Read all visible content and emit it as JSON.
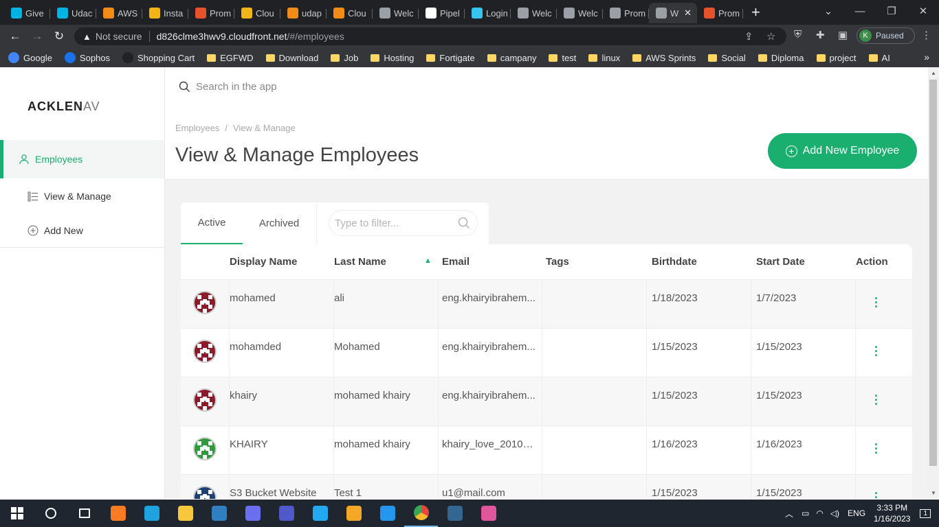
{
  "browser": {
    "tabs": [
      {
        "title": "Give",
        "icon": "udacity-icon",
        "color": "#02b3e4"
      },
      {
        "title": "Udac",
        "icon": "udacity-icon",
        "color": "#02b3e4"
      },
      {
        "title": "AWS",
        "icon": "aws-icon",
        "color": "#f28b18"
      },
      {
        "title": "Insta",
        "icon": "package-icon",
        "color": "#f2b418"
      },
      {
        "title": "Prom",
        "icon": "prometheus-icon",
        "color": "#e6522c"
      },
      {
        "title": "Clou",
        "icon": "cloudformation-icon",
        "color": "#f2b418"
      },
      {
        "title": "udap",
        "icon": "aws-icon",
        "color": "#f28b18"
      },
      {
        "title": "Clou",
        "icon": "aws-icon",
        "color": "#f28b18"
      },
      {
        "title": "Welc",
        "icon": "globe-icon",
        "color": "#9aa0a6"
      },
      {
        "title": "Pipel",
        "icon": "circleci-icon",
        "color": "#ffffff"
      },
      {
        "title": "Login",
        "icon": "slack-icon",
        "color": "#36c5f0"
      },
      {
        "title": "Welc",
        "icon": "globe-icon",
        "color": "#9aa0a6"
      },
      {
        "title": "Welc",
        "icon": "globe-icon",
        "color": "#9aa0a6"
      },
      {
        "title": "Prom",
        "icon": "page-icon",
        "color": "#9aa0a6"
      },
      {
        "title": "W",
        "icon": "globe-icon",
        "color": "#9aa0a6",
        "active": true
      },
      {
        "title": "Prom",
        "icon": "prometheus-icon",
        "color": "#e6522c"
      }
    ],
    "security_label": "Not secure",
    "url_host": "d826clme3hwv9.cloudfront.net",
    "url_path": "/#/employees",
    "profile_initial": "K",
    "profile_status": "Paused",
    "bookmarks": [
      {
        "label": "Google",
        "type": "site",
        "color": "#4285f4"
      },
      {
        "label": "Sophos",
        "type": "site",
        "color": "#1a73e8"
      },
      {
        "label": "Shopping Cart",
        "type": "site",
        "color": "#222"
      },
      {
        "label": "EGFWD",
        "type": "folder"
      },
      {
        "label": "Download",
        "type": "folder"
      },
      {
        "label": "Job",
        "type": "folder"
      },
      {
        "label": "Hosting",
        "type": "folder"
      },
      {
        "label": "Fortigate",
        "type": "folder"
      },
      {
        "label": "campany",
        "type": "folder"
      },
      {
        "label": "test",
        "type": "folder"
      },
      {
        "label": "linux",
        "type": "folder"
      },
      {
        "label": "AWS Sprints",
        "type": "folder"
      },
      {
        "label": "Social",
        "type": "folder"
      },
      {
        "label": "Diploma",
        "type": "folder"
      },
      {
        "label": "project",
        "type": "folder"
      },
      {
        "label": "AI",
        "type": "folder"
      }
    ]
  },
  "app": {
    "logo_bold": "ACKLEN",
    "logo_light": "AV",
    "search_placeholder": "Search in the app",
    "sidebar": {
      "section": "Employees",
      "items": [
        {
          "label": "View & Manage",
          "icon": "list-icon"
        },
        {
          "label": "Add New",
          "icon": "plus-circle-icon"
        }
      ]
    },
    "breadcrumb": [
      "Employees",
      "/",
      "View & Manage"
    ],
    "title": "View & Manage Employees",
    "add_button": "Add New Employee",
    "tabs": [
      "Active",
      "Archived"
    ],
    "filter_placeholder": "Type to filter...",
    "columns": [
      "Display Name",
      "Last Name",
      "Email",
      "Tags",
      "Birthdate",
      "Start Date",
      "Action"
    ],
    "rows": [
      {
        "display_name": "mohamed",
        "last_name": "ali",
        "email": "eng.khairyibrahem...",
        "tags": "",
        "birthdate": "1/18/2023",
        "start_date": "1/7/2023",
        "avatar_color": "#8b1a2b"
      },
      {
        "display_name": "mohamded",
        "last_name": "Mohamed",
        "email": "eng.khairyibrahem...",
        "tags": "",
        "birthdate": "1/15/2023",
        "start_date": "1/15/2023",
        "avatar_color": "#8b1a2b"
      },
      {
        "display_name": "khairy",
        "last_name": "mohamed khairy",
        "email": "eng.khairyibrahem...",
        "tags": "",
        "birthdate": "1/15/2023",
        "start_date": "1/15/2023",
        "avatar_color": "#8b1a2b"
      },
      {
        "display_name": "KHAIRY",
        "last_name": "mohamed khairy",
        "email": "khairy_love_2010@...",
        "tags": "",
        "birthdate": "1/16/2023",
        "start_date": "1/16/2023",
        "avatar_color": "#2e9a3c"
      },
      {
        "display_name": "S3 Bucket Website",
        "last_name": "Test 1",
        "email": "u1@mail.com",
        "tags": "",
        "birthdate": "1/15/2023",
        "start_date": "1/15/2023",
        "avatar_color": "#1d3f73"
      }
    ]
  },
  "taskbar": {
    "language": "ENG",
    "time": "3:33 PM",
    "date": "1/16/2023",
    "notification_count": "1",
    "apps": [
      {
        "name": "search-icon",
        "color": "#ffffff"
      },
      {
        "name": "task-view-icon",
        "color": "#ffffff"
      },
      {
        "name": "xampp-icon",
        "color": "#fb7a24"
      },
      {
        "name": "edge-icon",
        "color": "#1fa3e0"
      },
      {
        "name": "file-explorer-icon",
        "color": "#f8c83c"
      },
      {
        "name": "virtualbox-icon",
        "color": "#2f7fc1"
      },
      {
        "name": "1password-icon",
        "color": "#6a6ff0"
      },
      {
        "name": "teams-icon",
        "color": "#5059c9"
      },
      {
        "name": "vscode-icon",
        "color": "#23a9f2"
      },
      {
        "name": "git-icon",
        "color": "#f4a825"
      },
      {
        "name": "docker-icon",
        "color": "#2496ed"
      },
      {
        "name": "chrome-icon",
        "color": "#e8453c",
        "active": true
      },
      {
        "name": "pgadmin-icon",
        "color": "#336791"
      },
      {
        "name": "chrome-canary-icon",
        "color": "#e0569b"
      }
    ]
  }
}
